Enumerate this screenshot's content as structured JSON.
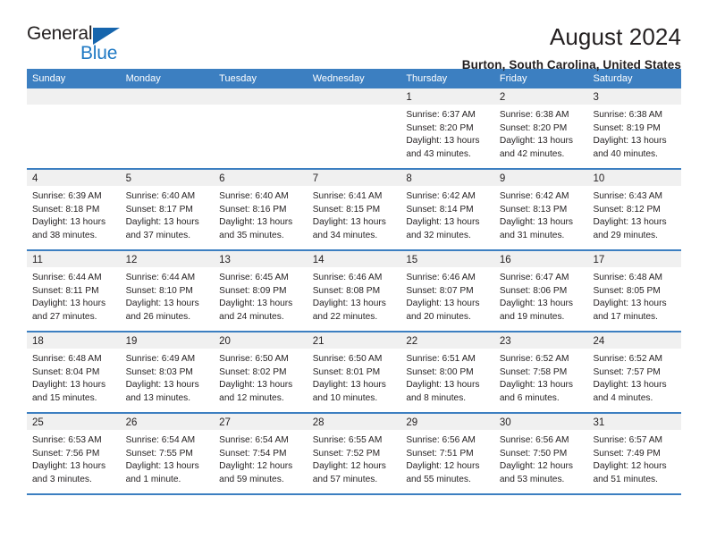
{
  "logo": {
    "word1": "General",
    "word2": "Blue",
    "triangle_color": "#1665ad",
    "blue_color": "#1f79c4"
  },
  "header": {
    "title": "August 2024",
    "subtitle": "Burton, South Carolina, United States"
  },
  "theme": {
    "header_blue": "#3c7fc1",
    "daynum_band": "#f0f0f0",
    "text": "#231f20"
  },
  "weekday_headers": [
    "Sunday",
    "Monday",
    "Tuesday",
    "Wednesday",
    "Thursday",
    "Friday",
    "Saturday"
  ],
  "weeks": [
    [
      {
        "day": "",
        "lines": []
      },
      {
        "day": "",
        "lines": []
      },
      {
        "day": "",
        "lines": []
      },
      {
        "day": "",
        "lines": []
      },
      {
        "day": "1",
        "lines": [
          "Sunrise: 6:37 AM",
          "Sunset: 8:20 PM",
          "Daylight: 13 hours",
          "and 43 minutes."
        ]
      },
      {
        "day": "2",
        "lines": [
          "Sunrise: 6:38 AM",
          "Sunset: 8:20 PM",
          "Daylight: 13 hours",
          "and 42 minutes."
        ]
      },
      {
        "day": "3",
        "lines": [
          "Sunrise: 6:38 AM",
          "Sunset: 8:19 PM",
          "Daylight: 13 hours",
          "and 40 minutes."
        ]
      }
    ],
    [
      {
        "day": "4",
        "lines": [
          "Sunrise: 6:39 AM",
          "Sunset: 8:18 PM",
          "Daylight: 13 hours",
          "and 38 minutes."
        ]
      },
      {
        "day": "5",
        "lines": [
          "Sunrise: 6:40 AM",
          "Sunset: 8:17 PM",
          "Daylight: 13 hours",
          "and 37 minutes."
        ]
      },
      {
        "day": "6",
        "lines": [
          "Sunrise: 6:40 AM",
          "Sunset: 8:16 PM",
          "Daylight: 13 hours",
          "and 35 minutes."
        ]
      },
      {
        "day": "7",
        "lines": [
          "Sunrise: 6:41 AM",
          "Sunset: 8:15 PM",
          "Daylight: 13 hours",
          "and 34 minutes."
        ]
      },
      {
        "day": "8",
        "lines": [
          "Sunrise: 6:42 AM",
          "Sunset: 8:14 PM",
          "Daylight: 13 hours",
          "and 32 minutes."
        ]
      },
      {
        "day": "9",
        "lines": [
          "Sunrise: 6:42 AM",
          "Sunset: 8:13 PM",
          "Daylight: 13 hours",
          "and 31 minutes."
        ]
      },
      {
        "day": "10",
        "lines": [
          "Sunrise: 6:43 AM",
          "Sunset: 8:12 PM",
          "Daylight: 13 hours",
          "and 29 minutes."
        ]
      }
    ],
    [
      {
        "day": "11",
        "lines": [
          "Sunrise: 6:44 AM",
          "Sunset: 8:11 PM",
          "Daylight: 13 hours",
          "and 27 minutes."
        ]
      },
      {
        "day": "12",
        "lines": [
          "Sunrise: 6:44 AM",
          "Sunset: 8:10 PM",
          "Daylight: 13 hours",
          "and 26 minutes."
        ]
      },
      {
        "day": "13",
        "lines": [
          "Sunrise: 6:45 AM",
          "Sunset: 8:09 PM",
          "Daylight: 13 hours",
          "and 24 minutes."
        ]
      },
      {
        "day": "14",
        "lines": [
          "Sunrise: 6:46 AM",
          "Sunset: 8:08 PM",
          "Daylight: 13 hours",
          "and 22 minutes."
        ]
      },
      {
        "day": "15",
        "lines": [
          "Sunrise: 6:46 AM",
          "Sunset: 8:07 PM",
          "Daylight: 13 hours",
          "and 20 minutes."
        ]
      },
      {
        "day": "16",
        "lines": [
          "Sunrise: 6:47 AM",
          "Sunset: 8:06 PM",
          "Daylight: 13 hours",
          "and 19 minutes."
        ]
      },
      {
        "day": "17",
        "lines": [
          "Sunrise: 6:48 AM",
          "Sunset: 8:05 PM",
          "Daylight: 13 hours",
          "and 17 minutes."
        ]
      }
    ],
    [
      {
        "day": "18",
        "lines": [
          "Sunrise: 6:48 AM",
          "Sunset: 8:04 PM",
          "Daylight: 13 hours",
          "and 15 minutes."
        ]
      },
      {
        "day": "19",
        "lines": [
          "Sunrise: 6:49 AM",
          "Sunset: 8:03 PM",
          "Daylight: 13 hours",
          "and 13 minutes."
        ]
      },
      {
        "day": "20",
        "lines": [
          "Sunrise: 6:50 AM",
          "Sunset: 8:02 PM",
          "Daylight: 13 hours",
          "and 12 minutes."
        ]
      },
      {
        "day": "21",
        "lines": [
          "Sunrise: 6:50 AM",
          "Sunset: 8:01 PM",
          "Daylight: 13 hours",
          "and 10 minutes."
        ]
      },
      {
        "day": "22",
        "lines": [
          "Sunrise: 6:51 AM",
          "Sunset: 8:00 PM",
          "Daylight: 13 hours",
          "and 8 minutes."
        ]
      },
      {
        "day": "23",
        "lines": [
          "Sunrise: 6:52 AM",
          "Sunset: 7:58 PM",
          "Daylight: 13 hours",
          "and 6 minutes."
        ]
      },
      {
        "day": "24",
        "lines": [
          "Sunrise: 6:52 AM",
          "Sunset: 7:57 PM",
          "Daylight: 13 hours",
          "and 4 minutes."
        ]
      }
    ],
    [
      {
        "day": "25",
        "lines": [
          "Sunrise: 6:53 AM",
          "Sunset: 7:56 PM",
          "Daylight: 13 hours",
          "and 3 minutes."
        ]
      },
      {
        "day": "26",
        "lines": [
          "Sunrise: 6:54 AM",
          "Sunset: 7:55 PM",
          "Daylight: 13 hours",
          "and 1 minute."
        ]
      },
      {
        "day": "27",
        "lines": [
          "Sunrise: 6:54 AM",
          "Sunset: 7:54 PM",
          "Daylight: 12 hours",
          "and 59 minutes."
        ]
      },
      {
        "day": "28",
        "lines": [
          "Sunrise: 6:55 AM",
          "Sunset: 7:52 PM",
          "Daylight: 12 hours",
          "and 57 minutes."
        ]
      },
      {
        "day": "29",
        "lines": [
          "Sunrise: 6:56 AM",
          "Sunset: 7:51 PM",
          "Daylight: 12 hours",
          "and 55 minutes."
        ]
      },
      {
        "day": "30",
        "lines": [
          "Sunrise: 6:56 AM",
          "Sunset: 7:50 PM",
          "Daylight: 12 hours",
          "and 53 minutes."
        ]
      },
      {
        "day": "31",
        "lines": [
          "Sunrise: 6:57 AM",
          "Sunset: 7:49 PM",
          "Daylight: 12 hours",
          "and 51 minutes."
        ]
      }
    ]
  ]
}
